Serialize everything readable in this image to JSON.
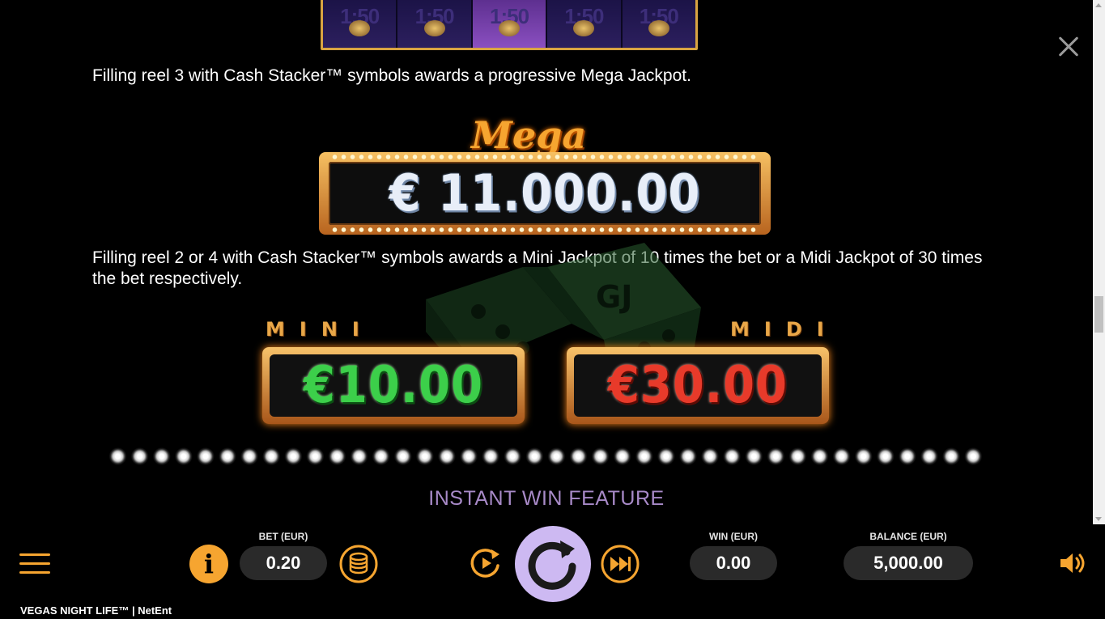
{
  "paytable": {
    "reel_values": [
      "1:50",
      "1:50",
      "1:50",
      "1:50",
      "1:50"
    ],
    "mega_text": "Filling reel 3 with Cash Stacker™ symbols awards a progressive Mega Jackpot.",
    "mega_label": "Mega",
    "mega_amount": "€ 11.000.00",
    "mini_midi_text": "Filling reel 2 or 4 with Cash Stacker™ symbols awards a Mini Jackpot of 10 times the bet or a Midi Jackpot of 30 times the bet respectively.",
    "mini_label": "MINI",
    "mini_amount": "€10.00",
    "midi_label": "MIDI",
    "midi_amount": "€30.00",
    "section_heading": "INSTANT WIN FEATURE"
  },
  "controls": {
    "info_icon": "i",
    "bet_label": "BET (EUR)",
    "bet_value": "0.20",
    "win_label": "WIN (EUR)",
    "win_value": "0.00",
    "balance_label": "BALANCE (EUR)",
    "balance_value": "5,000.00"
  },
  "footer": {
    "brand": "VEGAS NIGHT LIFE™  |  NetEnt"
  },
  "icons": [
    "close-icon",
    "menu-icon",
    "info-icon",
    "coins-icon",
    "autoplay-icon",
    "spin-icon",
    "fast-forward-icon",
    "sound-icon"
  ],
  "colors": {
    "accent": "#f6a530",
    "spin_button": "#cdb9f2",
    "heading": "#a88ac8",
    "pill_bg": "#2a2a2a"
  }
}
